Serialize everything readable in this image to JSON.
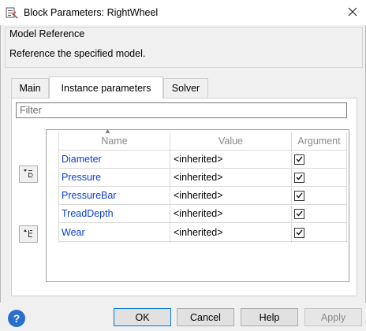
{
  "window": {
    "title": "Block Parameters: RightWheel"
  },
  "group": {
    "title": "Model Reference",
    "description": "Reference the specified model."
  },
  "tabs": [
    {
      "label": "Main",
      "active": false
    },
    {
      "label": "Instance parameters",
      "active": true
    },
    {
      "label": "Solver",
      "active": false
    }
  ],
  "filter": {
    "placeholder": "Filter",
    "value": ""
  },
  "table": {
    "columns": [
      "Name",
      "Value",
      "Argument"
    ],
    "rows": [
      {
        "name": "Diameter",
        "value": "<inherited>",
        "argument": true
      },
      {
        "name": "Pressure",
        "value": "<inherited>",
        "argument": true
      },
      {
        "name": "PressureBar",
        "value": "<inherited>",
        "argument": true
      },
      {
        "name": "TreadDepth",
        "value": "<inherited>",
        "argument": true
      },
      {
        "name": "Wear",
        "value": "<inherited>",
        "argument": true
      }
    ]
  },
  "buttons": {
    "ok": "OK",
    "cancel": "Cancel",
    "help": "Help",
    "apply": "Apply"
  },
  "icons": {
    "app": "simulink-block-icon",
    "close": "close-icon",
    "promote": "promote-parameter-icon",
    "demote": "demote-parameter-icon",
    "help": "help-icon"
  },
  "colors": {
    "link": "#0b3fd6",
    "help_icon": "#2a6fce",
    "default_button_border": "#0078d7"
  }
}
